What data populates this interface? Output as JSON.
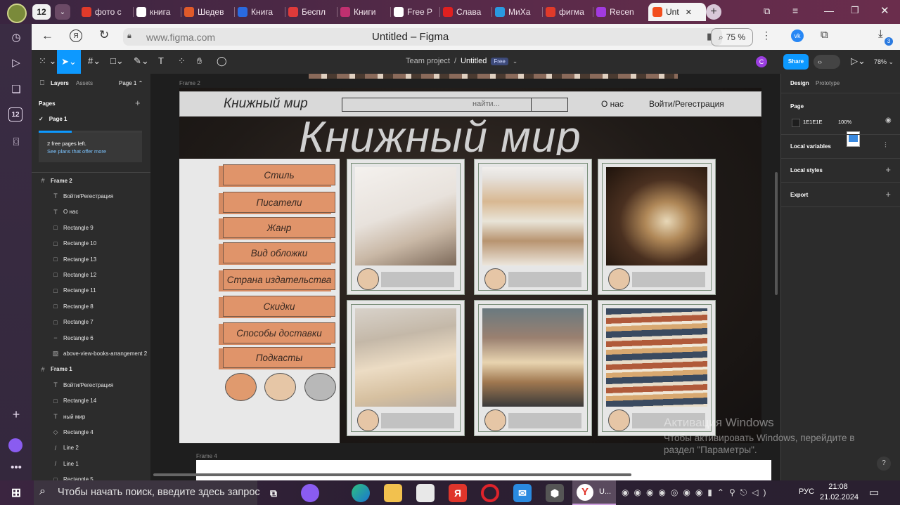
{
  "browser": {
    "badge": "12",
    "tabs": [
      {
        "label": "фото с",
        "color": "#e03a2a"
      },
      {
        "label": "книга",
        "color": "#ffffff"
      },
      {
        "label": "Шедев",
        "color": "#e05a2a"
      },
      {
        "label": "Книга",
        "color": "#2a6ae0"
      },
      {
        "label": "Беспл",
        "color": "#e03a3a"
      },
      {
        "label": "Книги",
        "color": "#c03070"
      },
      {
        "label": "Free P",
        "color": "#ffffff"
      },
      {
        "label": "Слава",
        "color": "#e02020"
      },
      {
        "label": "МиХа",
        "color": "#2a9ae0"
      },
      {
        "label": "фигма",
        "color": "#e03a2a"
      },
      {
        "label": "Recen",
        "color": "#a23ae0"
      },
      {
        "label": "Unt",
        "color": "#f24e1e"
      }
    ],
    "url": "www.figma.com",
    "page_title": "Untitled – Figma",
    "zoom": "75 %",
    "downloads_badge": "3"
  },
  "figma": {
    "breadcrumb_team": "Team project",
    "breadcrumb_sep": "/",
    "file_name": "Untitled",
    "plan_badge": "Free",
    "user_initial": "C",
    "share": "Share",
    "zoom": "78%",
    "left_tabs": {
      "layers": "Layers",
      "assets": "Assets",
      "page": "Page 1"
    },
    "pages_title": "Pages",
    "page_item": "Page 1",
    "promo_line1": "2 free pages left.",
    "promo_line2": "See plans that offer more",
    "layers": [
      {
        "name": "Frame 2",
        "icon": "#",
        "bold": true
      },
      {
        "name": "Войти/Регестрация",
        "icon": "T"
      },
      {
        "name": "О нас",
        "icon": "T"
      },
      {
        "name": "Rectangle 9",
        "icon": "□"
      },
      {
        "name": "Rectangle 10",
        "icon": "□"
      },
      {
        "name": "Rectangle 13",
        "icon": "□"
      },
      {
        "name": "Rectangle 12",
        "icon": "□"
      },
      {
        "name": "Rectangle 11",
        "icon": "□"
      },
      {
        "name": "Rectangle 8",
        "icon": "□"
      },
      {
        "name": "Rectangle 7",
        "icon": "□"
      },
      {
        "name": "Rectangle 6",
        "icon": "−"
      },
      {
        "name": "above-view-books-arrangement 2",
        "icon": "▧"
      },
      {
        "name": "Frame 1",
        "icon": "#",
        "bold": true
      },
      {
        "name": "Войти/Регестрация",
        "icon": "T"
      },
      {
        "name": "Rectangle 14",
        "icon": "□"
      },
      {
        "name": "ный мир",
        "icon": "T"
      },
      {
        "name": "Rectangle 4",
        "icon": "◇"
      },
      {
        "name": "Line 2",
        "icon": "/"
      },
      {
        "name": "Line 1",
        "icon": "/"
      },
      {
        "name": "Rectangle 5",
        "icon": "□"
      }
    ],
    "right_tabs": {
      "design": "Design",
      "prototype": "Prototype"
    },
    "page_section": "Page",
    "bg_hex": "1E1E1E",
    "bg_opacity": "100%",
    "local_variables": "Local variables",
    "local_styles": "Local styles",
    "export": "Export",
    "frame2_label": "Frame 2",
    "frame4_label": "Frame 4"
  },
  "design": {
    "logo": "Книжный мир",
    "search_placeholder": "найти...",
    "nav_about": "О нас",
    "nav_login": "Войти/Регестрация",
    "hero": "Книжный мир",
    "categories": [
      "Стиль",
      "Писатели",
      "Жанр",
      "Вид обложки",
      "Страна издательства",
      "Скидки",
      "Способы доставки",
      "Подкасты"
    ],
    "swatches": [
      "#e09a6e",
      "#e6c6a6",
      "#b8b8b8"
    ]
  },
  "watermark": {
    "title": "Активация Windows",
    "line1": "Чтобы активировать Windows, перейдите в",
    "line2": "раздел \"Параметры\"."
  },
  "taskbar": {
    "search_placeholder": "Чтобы начать поиск, введите здесь запрос",
    "active_app": "U...",
    "lang": "РУС",
    "time": "21:08",
    "date": "21.02.2024"
  }
}
